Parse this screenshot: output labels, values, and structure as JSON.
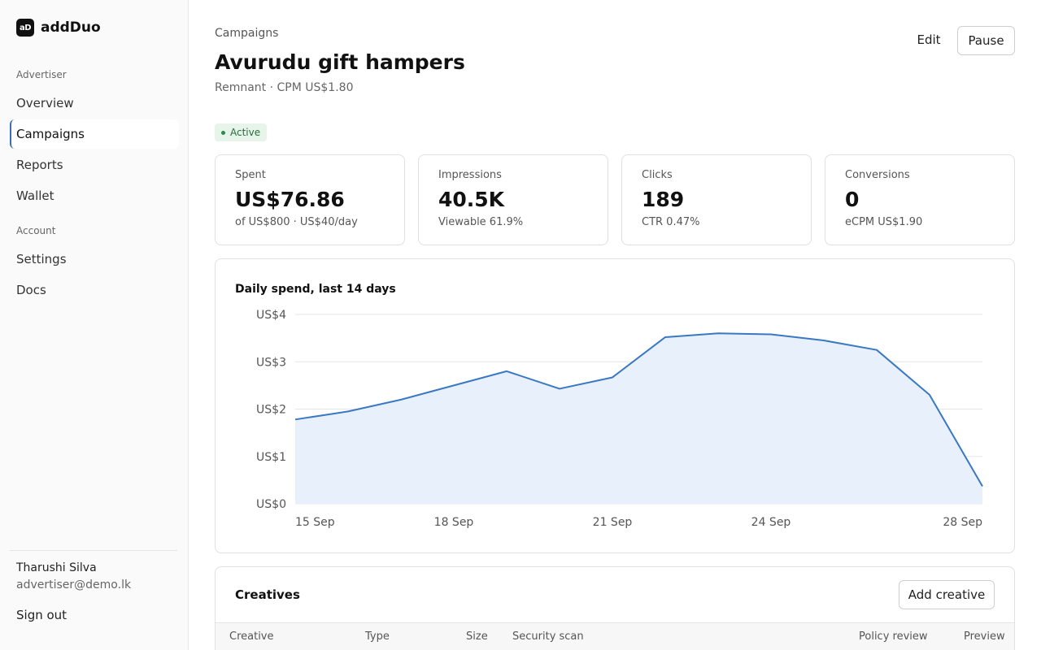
{
  "brand": {
    "logo_text": "aD",
    "name": "addDuo"
  },
  "sidebar": {
    "section_advertiser": "Advertiser",
    "items": [
      {
        "label": "Overview"
      },
      {
        "label": "Campaigns"
      },
      {
        "label": "Reports"
      },
      {
        "label": "Wallet"
      }
    ],
    "section_account": "Account",
    "account_items": [
      {
        "label": "Settings"
      },
      {
        "label": "Docs"
      }
    ],
    "user": {
      "name": "Tharushi Silva",
      "email": "advertiser@demo.lk"
    },
    "sign_out": "Sign out"
  },
  "header": {
    "breadcrumb": "Campaigns",
    "title": "Avurudu gift hampers",
    "subtitle": "Remnant · CPM US$1.80",
    "edit_label": "Edit",
    "pause_label": "Pause",
    "status": "Active"
  },
  "stats": [
    {
      "label": "Spent",
      "value": "US$76.86",
      "sub": "of US$800 · US$40/day"
    },
    {
      "label": "Impressions",
      "value": "40.5K",
      "sub": "Viewable 61.9%"
    },
    {
      "label": "Clicks",
      "value": "189",
      "sub": "CTR 0.47%"
    },
    {
      "label": "Conversions",
      "value": "0",
      "sub": "eCPM US$1.90"
    }
  ],
  "chart_data": {
    "type": "area",
    "title": "Daily spend, last 14 days",
    "x": [
      "15 Sep",
      "16 Sep",
      "17 Sep",
      "18 Sep",
      "19 Sep",
      "20 Sep",
      "21 Sep",
      "22 Sep",
      "23 Sep",
      "24 Sep",
      "25 Sep",
      "26 Sep",
      "27 Sep",
      "28 Sep"
    ],
    "values": [
      1.78,
      1.95,
      2.2,
      2.5,
      2.8,
      2.43,
      2.67,
      3.52,
      3.6,
      3.58,
      3.45,
      3.25,
      2.3,
      0.37
    ],
    "x_ticks": [
      "15 Sep",
      "18 Sep",
      "21 Sep",
      "24 Sep",
      "28 Sep"
    ],
    "y_ticks": [
      "US$0",
      "US$1",
      "US$2",
      "US$3",
      "US$4"
    ],
    "ylim": [
      0,
      4
    ],
    "grid": true,
    "line_color": "#3a78c2",
    "fill_color": "#e7f0fb"
  },
  "creatives": {
    "title": "Creatives",
    "add_label": "Add creative",
    "columns": [
      "Creative",
      "Type",
      "Size",
      "Security scan",
      "Policy review",
      "Preview"
    ]
  },
  "colors": {
    "accent": "#3a6fb0",
    "status_bg": "#e6f4ea",
    "status_text": "#2d6a3e"
  }
}
